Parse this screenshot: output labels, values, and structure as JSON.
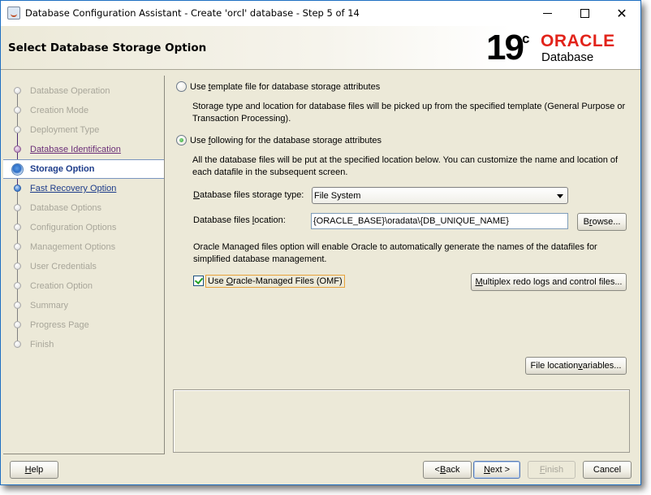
{
  "window": {
    "title": "Database Configuration Assistant - Create 'orcl' database - Step 5 of 14",
    "controls": {
      "minimize": "minimize",
      "maximize": "maximize",
      "close": "✕"
    }
  },
  "header": {
    "page_title": "Select Database Storage Option",
    "logo": {
      "version": "19",
      "version_suffix": "c",
      "brand": "ORACLE",
      "product": "Database",
      "brand_color": "#e2231a"
    }
  },
  "steps": [
    {
      "label": "Database Operation",
      "state": "disabled"
    },
    {
      "label": "Creation Mode",
      "state": "disabled"
    },
    {
      "label": "Deployment Type",
      "state": "disabled"
    },
    {
      "label": "Database Identification",
      "state": "visited"
    },
    {
      "label": "Storage Option",
      "state": "current"
    },
    {
      "label": "Fast Recovery Option",
      "state": "next"
    },
    {
      "label": "Database Options",
      "state": "disabled"
    },
    {
      "label": "Configuration Options",
      "state": "disabled"
    },
    {
      "label": "Management Options",
      "state": "disabled"
    },
    {
      "label": "User Credentials",
      "state": "disabled"
    },
    {
      "label": "Creation Option",
      "state": "disabled"
    },
    {
      "label": "Summary",
      "state": "disabled"
    },
    {
      "label": "Progress Page",
      "state": "disabled"
    },
    {
      "label": "Finish",
      "state": "disabled"
    }
  ],
  "content": {
    "option_template": {
      "label_pre": "Use ",
      "label_mnemonic": "t",
      "label_post": "emplate file for database storage attributes",
      "selected": false,
      "desc_line1": "Storage type and location for database files will be picked up from the specified template (General Purpose or",
      "desc_line2": "Transaction Processing)."
    },
    "option_following": {
      "label_pre": "Use ",
      "label_mnemonic": "f",
      "label_post": "ollowing for the database storage attributes",
      "selected": true,
      "desc_line1": "All the database files will be put at the specified location below. You can customize the name and location of",
      "desc_line2": "each datafile in the subsequent screen."
    },
    "storage_type": {
      "label_mnemonic": "D",
      "label_post": "atabase files storage type:",
      "value": "File System"
    },
    "location": {
      "label_pre": "Database files ",
      "label_mnemonic": "l",
      "label_post": "ocation:",
      "value": "{ORACLE_BASE}\\oradata\\{DB_UNIQUE_NAME}"
    },
    "browse_button": {
      "pre": "B",
      "mnemonic": "r",
      "post": "owse..."
    },
    "omf_desc_line1": "Oracle Managed files option will enable Oracle to automatically generate the names of the datafiles for",
    "omf_desc_line2": "simplified database management.",
    "omf_checkbox": {
      "pre": "Use ",
      "mnemonic": "O",
      "post": "racle-Managed Files (OMF)",
      "checked": true
    },
    "multiplex_button": {
      "mnemonic": "M",
      "post": "ultiplex redo logs and control files..."
    },
    "file_location_button": {
      "pre": "File location ",
      "mnemonic": "v",
      "post": "ariables..."
    }
  },
  "footer": {
    "help": {
      "mnemonic": "H",
      "post": "elp"
    },
    "back": {
      "pre": "< ",
      "mnemonic": "B",
      "post": "ack"
    },
    "next": {
      "mnemonic": "N",
      "post": "ext >"
    },
    "finish": {
      "mnemonic": "F",
      "post": "inish",
      "enabled": false
    },
    "cancel": "Cancel"
  }
}
